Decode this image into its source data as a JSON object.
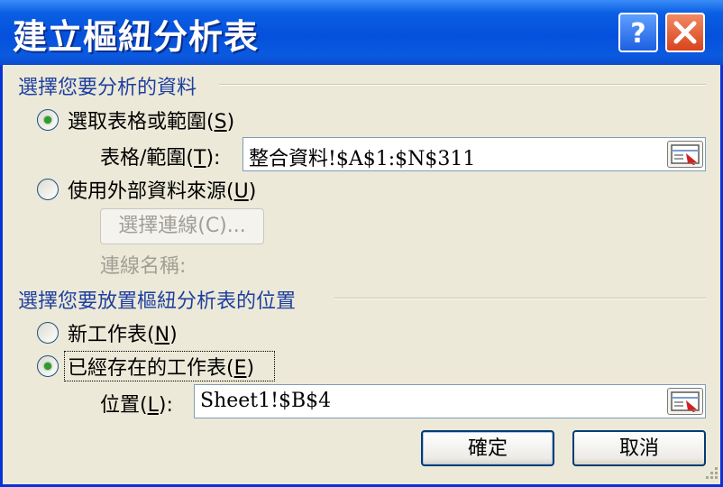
{
  "window": {
    "title": "建立樞紐分析表",
    "help_icon": "help-question-icon",
    "close_icon": "close-x-icon"
  },
  "section1": {
    "heading": "選擇您要分析的資料",
    "option_table": {
      "label_pre": "選取表格或範圍(",
      "key": "S",
      "label_post": ")",
      "selected": true
    },
    "range_label": {
      "pre": "表格/範圍(",
      "key": "T",
      "post": "):"
    },
    "range_value": "整合資料!$A$1:$N$311",
    "option_external": {
      "label_pre": "使用外部資料來源(",
      "key": "U",
      "label_post": ")",
      "selected": false
    },
    "choose_conn_button": "選擇連線(C)...",
    "conn_name_label": "連線名稱:"
  },
  "section2": {
    "heading": "選擇您要放置樞紐分析表的位置",
    "option_new": {
      "label_pre": "新工作表(",
      "key": "N",
      "label_post": ")",
      "selected": false
    },
    "option_existing": {
      "label_pre": "已經存在的工作表(",
      "key": "E",
      "label_post": ")",
      "selected": true
    },
    "location_label": {
      "pre": "位置(",
      "key": "L",
      "post": "):"
    },
    "location_value": "Sheet1!$B$4"
  },
  "buttons": {
    "ok": "確定",
    "cancel": "取消"
  },
  "colors": {
    "titlebar": "#0550dc",
    "dialog_bg": "#ece9d8",
    "section_heading": "#1e3fa0",
    "radio_selected": "#2f9a2f"
  }
}
